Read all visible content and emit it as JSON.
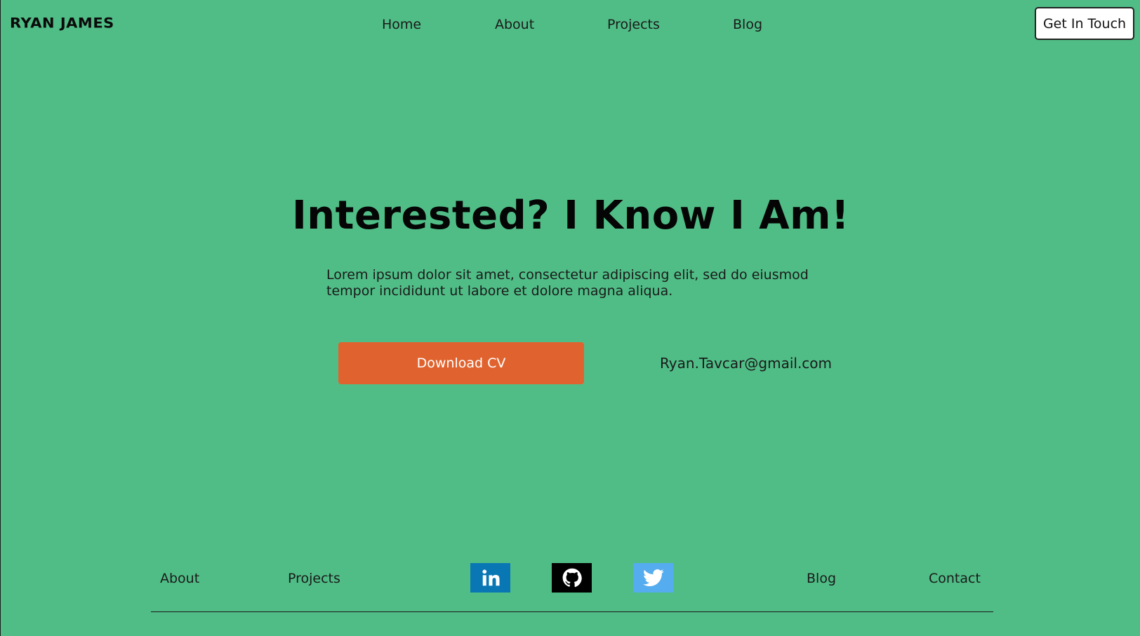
{
  "brand": {
    "name": "RYAN JAMES"
  },
  "nav": {
    "items": [
      {
        "label": "Home"
      },
      {
        "label": "About"
      },
      {
        "label": "Projects"
      },
      {
        "label": "Blog"
      }
    ],
    "cta_label": "Get In Touch"
  },
  "hero": {
    "title": "Interested? I Know I Am!",
    "body": "Lorem ipsum dolor sit amet, consectetur adipiscing elit, sed do eiusmod tempor incididunt ut labore et dolore magna aliqua.",
    "download_label": "Download CV",
    "email": "Ryan.Tavcar@gmail.com"
  },
  "footer": {
    "links_left": [
      {
        "label": "About"
      },
      {
        "label": "Projects"
      }
    ],
    "links_right": [
      {
        "label": "Blog"
      },
      {
        "label": "Contact"
      }
    ],
    "social": [
      {
        "name": "linkedin-icon",
        "color": "#0a77b5"
      },
      {
        "name": "github-icon",
        "color": "#000000"
      },
      {
        "name": "twitter-icon",
        "color": "#55acee"
      }
    ]
  },
  "colors": {
    "background": "#50bd86",
    "accent": "#e0632f",
    "text": "#111111"
  }
}
